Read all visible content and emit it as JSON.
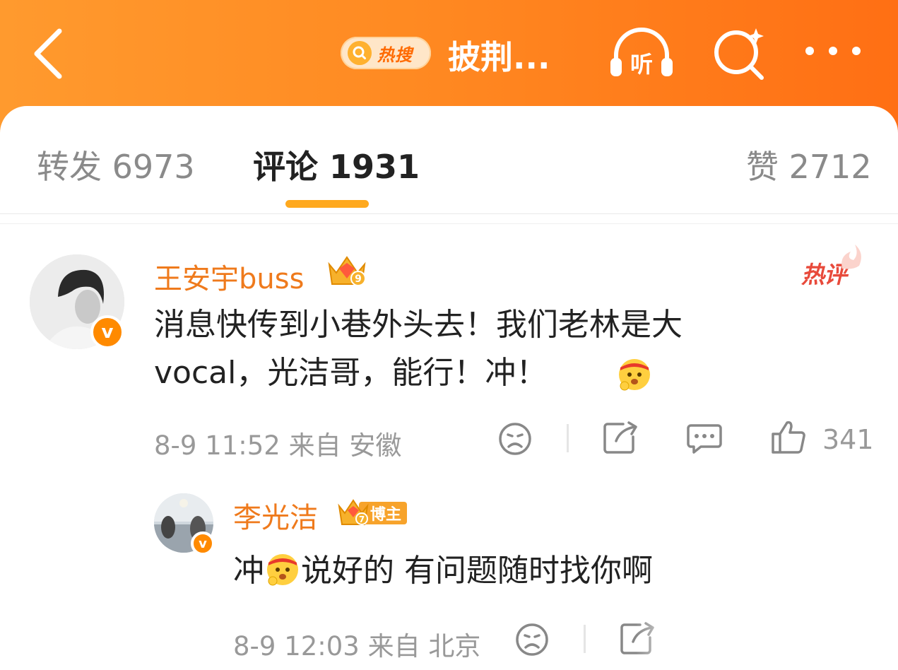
{
  "header": {
    "hot_search_label": "热搜",
    "title": "披荆...",
    "listen_label": "听"
  },
  "tabs": [
    {
      "label": "转发 6973"
    },
    {
      "label": "评论 1931"
    },
    {
      "label": "赞 2712"
    }
  ],
  "comments": [
    {
      "username": "王安宇buss",
      "crown_level": "9",
      "hot_tag": "热评",
      "text_line1": "消息快传到小巷外头去！我们老林是大",
      "text_line2": "vocal，光洁哥，能行！冲！",
      "meta": "8-9 11:52 来自 安徽",
      "likes": "341"
    },
    {
      "username": "李光洁",
      "crown_level": "7",
      "badge": "博主",
      "text_pre": "冲",
      "text_post": "说好的 有问题随时找你啊",
      "meta": "8-9 12:03 来自 北京"
    }
  ],
  "colors": {
    "header_start": "#ff9a2e",
    "header_end": "#ff6f14",
    "username": "#ef7a1c",
    "tab_indicator": "#ffa91e",
    "hot_tag": "#e84a3b"
  }
}
